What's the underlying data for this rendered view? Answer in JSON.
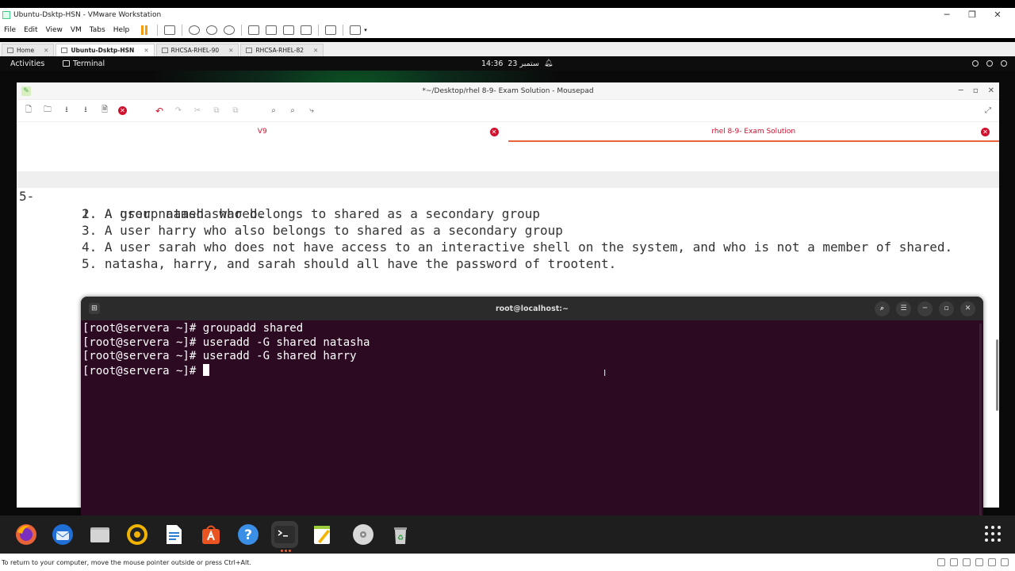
{
  "vmware": {
    "window_title": "Ubuntu-Dsktp-HSN - VMware Workstation",
    "menu": [
      "File",
      "Edit",
      "View",
      "VM",
      "Tabs",
      "Help"
    ],
    "tabs": [
      {
        "label": "Home"
      },
      {
        "label": "Ubuntu-Dsktp-HSN"
      },
      {
        "label": "RHCSA-RHEL-90"
      },
      {
        "label": "RHCSA-RHEL-82"
      }
    ],
    "status_text": "To return to your computer, move the mouse pointer outside or press Ctrl+Alt."
  },
  "gnome": {
    "activities": "Activities",
    "focused_app": "Terminal",
    "clock_time": "14:36",
    "clock_date": "23 ستمبر"
  },
  "mousepad": {
    "title": "*~/Desktop/rhel 8-9- Exam Solution - Mousepad",
    "tabs": [
      {
        "label": "V9"
      },
      {
        "label": "rhel 8-9- Exam Solution"
      }
    ],
    "line_number": "5-",
    "lines": [
      "1. A group named shared.",
      "2. A user natasha who belongs to shared as a secondary group",
      "3. A user harry who also belongs to shared as a secondary group",
      "4. A user sarah who does not have access to an interactive shell on the system, and who is not a member of shared.",
      "5. natasha, harry, and sarah should all have the password of trootent."
    ]
  },
  "terminal": {
    "title": "root@localhost:~",
    "lines": [
      "[root@servera ~]# groupadd shared",
      "[root@servera ~]# useradd -G shared natasha",
      "[root@servera ~]# useradd -G shared harry",
      "[root@servera ~]# "
    ],
    "colors": {
      "background": "#2c0a22",
      "text": "#ffffff"
    }
  },
  "dock": {
    "apps": [
      "firefox-icon",
      "thunderbird-icon",
      "files-icon",
      "rhythmbox-icon",
      "writer-icon",
      "app-center-icon",
      "help-icon",
      "terminal-icon",
      "text-editor-icon",
      "disc-icon",
      "trash-icon"
    ]
  }
}
